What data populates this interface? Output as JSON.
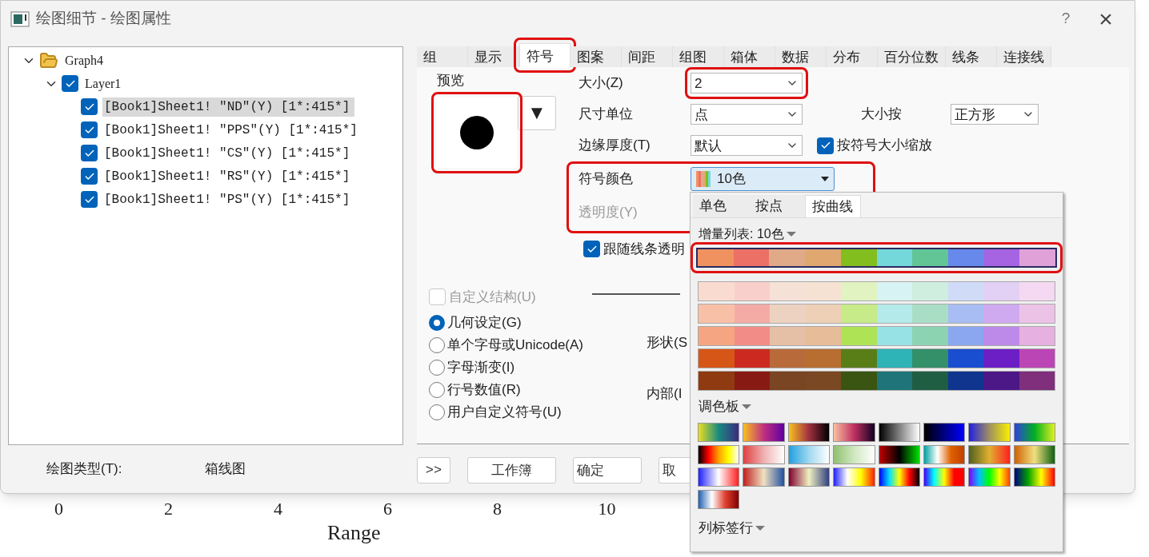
{
  "window": {
    "title": "绘图细节 - 绘图属性",
    "help": "?",
    "close": "×"
  },
  "tree": [
    {
      "label": "Graph4",
      "kind": "folder",
      "expanded": true,
      "children": [
        {
          "label": "Layer1",
          "kind": "layer",
          "expanded": true,
          "checked": true,
          "children": [
            {
              "label": "[Book1]Sheet1! ″ND″(Y) [1*:415*]",
              "kind": "plot",
              "checked": true,
              "selected": true
            },
            {
              "label": "[Book1]Sheet1! ″PPS″(Y) [1*:415*]",
              "kind": "plot",
              "checked": true,
              "selected": false
            },
            {
              "label": "[Book1]Sheet1! ″CS″(Y) [1*:415*]",
              "kind": "plot",
              "checked": true,
              "selected": false
            },
            {
              "label": "[Book1]Sheet1! ″RS″(Y) [1*:415*]",
              "kind": "plot",
              "checked": true,
              "selected": false
            },
            {
              "label": "[Book1]Sheet1! ″PS″(Y) [1*:415*]",
              "kind": "plot",
              "checked": true,
              "selected": false
            }
          ]
        }
      ]
    }
  ],
  "plot_type": {
    "label": "绘图类型(T):",
    "value": "箱线图"
  },
  "tabs": [
    {
      "label": "组",
      "selected": false,
      "highlighted": false
    },
    {
      "label": "显示",
      "selected": false,
      "highlighted": false
    },
    {
      "label": "符号",
      "selected": true,
      "highlighted": true
    },
    {
      "label": "图案",
      "selected": false,
      "highlighted": false
    },
    {
      "label": "间距",
      "selected": false,
      "highlighted": false
    },
    {
      "label": "组图",
      "selected": false,
      "highlighted": false
    },
    {
      "label": "箱体",
      "selected": false,
      "highlighted": false
    },
    {
      "label": "数据",
      "selected": false,
      "highlighted": false
    },
    {
      "label": "分布",
      "selected": false,
      "highlighted": false
    },
    {
      "label": "百分位数",
      "selected": false,
      "highlighted": false
    },
    {
      "label": "线条",
      "selected": false,
      "highlighted": false
    },
    {
      "label": "连接线",
      "selected": false,
      "highlighted": false
    }
  ],
  "preview": {
    "label": "预览",
    "menu_button": "▼",
    "highlighted": true
  },
  "size": {
    "label": "大小(Z)",
    "value": "2",
    "highlighted": true
  },
  "size_unit": {
    "label": "尺寸单位",
    "value": "点"
  },
  "size_by": {
    "label": "大小按",
    "value": "正方形"
  },
  "edge_thickness": {
    "label": "边缘厚度(T)",
    "value": "默认"
  },
  "scale_with_size": {
    "label": "按符号大小缩放",
    "checked": true
  },
  "symbol_color": {
    "label": "符号颜色",
    "value": "10色",
    "highlighted": true
  },
  "transparency": {
    "label": "透明度(Y)",
    "disabled": true
  },
  "follow_line_transparency": {
    "label": "跟随线条透明",
    "checked": true
  },
  "custom_construction": {
    "label": "自定义结构(U)",
    "checked": false,
    "disabled": true
  },
  "symbol_types": [
    {
      "label": "几何设定(G)",
      "selected": true
    },
    {
      "label": "单个字母或Unicode(A)",
      "selected": false
    },
    {
      "label": "字母渐变(I)",
      "selected": false
    },
    {
      "label": "行号数值(R)",
      "selected": false
    },
    {
      "label": "用户自定义符号(U)",
      "selected": false
    }
  ],
  "shape_label": "形状(S",
  "interior_label": "内部(I",
  "buttons": [
    ">>",
    "工作簿",
    "确定",
    "取"
  ],
  "color_popup": {
    "tabs": [
      {
        "label": "单色",
        "selected": false
      },
      {
        "label": "按点",
        "selected": false
      },
      {
        "label": "按曲线",
        "selected": true
      }
    ],
    "increment_list": "增量列表: 10色",
    "palette_rows": [
      {
        "selected": true,
        "highlighted": true,
        "swatches": [
          {
            "color": "#f0925f"
          },
          {
            "color": "#ec7065"
          },
          {
            "color": "#e0aa88"
          },
          {
            "color": "#e0a870"
          },
          {
            "color": "#82be1e"
          },
          {
            "color": "#74d8da"
          },
          {
            "color": "#62c596"
          },
          {
            "color": "#6689eb"
          },
          {
            "color": "#a664e2"
          },
          {
            "color": "#dfa1d8"
          }
        ]
      },
      {
        "selected": false,
        "highlighted": false,
        "swatches": [
          {
            "color": "#fadbd0"
          },
          {
            "color": "#f9cfcc"
          },
          {
            "color": "#f6e1d6"
          },
          {
            "color": "#f5e2d3"
          },
          {
            "color": "#e0f3c0"
          },
          {
            "color": "#d8f3f3"
          },
          {
            "color": "#cfeedf"
          },
          {
            "color": "#d0dbf8"
          },
          {
            "color": "#e3d0f5"
          },
          {
            "color": "#f5d9f2"
          }
        ]
      },
      {
        "selected": false,
        "highlighted": false,
        "swatches": [
          {
            "color": "#f8c0a6"
          },
          {
            "color": "#f5aba5"
          },
          {
            "color": "#eed2c1"
          },
          {
            "color": "#edd0b6"
          },
          {
            "color": "#c6eb88"
          },
          {
            "color": "#b5eaeb"
          },
          {
            "color": "#a9dec5"
          },
          {
            "color": "#a8bdf3"
          },
          {
            "color": "#d0aaf0"
          },
          {
            "color": "#ecc3e7"
          }
        ]
      },
      {
        "selected": false,
        "highlighted": false,
        "swatches": [
          {
            "color": "#f5a581"
          },
          {
            "color": "#f18d86"
          },
          {
            "color": "#e5bfa6"
          },
          {
            "color": "#e6bc99"
          },
          {
            "color": "#aee356"
          },
          {
            "color": "#97e2e4"
          },
          {
            "color": "#8cd3b1"
          },
          {
            "color": "#8ba7ef"
          },
          {
            "color": "#be8aea"
          },
          {
            "color": "#e6b0e0"
          }
        ]
      },
      {
        "selected": false,
        "highlighted": false,
        "swatches": [
          {
            "color": "#d65618"
          },
          {
            "color": "#cc2a20"
          },
          {
            "color": "#b96a3a"
          },
          {
            "color": "#b86e30"
          },
          {
            "color": "#5a7e17"
          },
          {
            "color": "#2eb3b6"
          },
          {
            "color": "#339068"
          },
          {
            "color": "#1a4ed0"
          },
          {
            "color": "#6c1fc4"
          },
          {
            "color": "#bc45b5"
          }
        ]
      },
      {
        "selected": false,
        "highlighted": false,
        "swatches": [
          {
            "color": "#8f3a10"
          },
          {
            "color": "#881a14"
          },
          {
            "color": "#7a4522"
          },
          {
            "color": "#7a4822"
          },
          {
            "color": "#3a5412"
          },
          {
            "color": "#1e7478"
          },
          {
            "color": "#1f5e43"
          },
          {
            "color": "#10358e"
          },
          {
            "color": "#4c1786"
          },
          {
            "color": "#7f2f7c"
          }
        ]
      }
    ],
    "palette_label": "调色板",
    "column_label_row": "列标签行"
  },
  "axis": {
    "ticks": [
      "0",
      "2",
      "4",
      "6",
      "8",
      "10"
    ],
    "title": "Range"
  }
}
